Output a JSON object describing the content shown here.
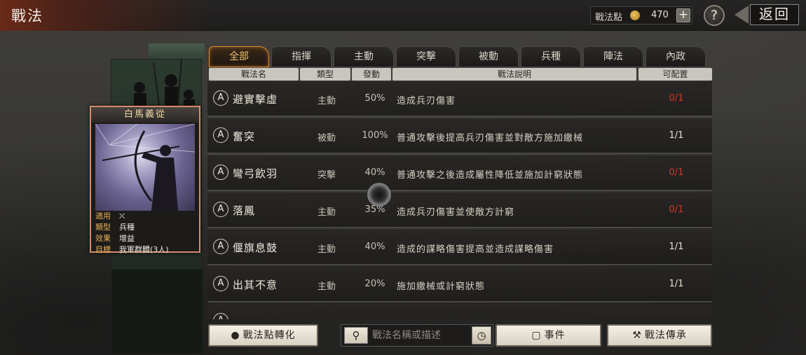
{
  "header": {
    "title": "戰法",
    "points_label": "戰法點",
    "points_icon": "coin-icon",
    "points_value": "470",
    "plus_label": "+",
    "help_label": "?",
    "back_label": "返回"
  },
  "card": {
    "name": "白馬義從",
    "info": [
      {
        "key": "適用",
        "value": "⛌"
      },
      {
        "key": "類型",
        "value": "兵種"
      },
      {
        "key": "效果",
        "value": "增益"
      },
      {
        "key": "目標",
        "value": "我軍群體(3人)"
      }
    ]
  },
  "tabs": [
    "全部",
    "指揮",
    "主動",
    "突擊",
    "被動",
    "兵種",
    "陣法",
    "內政"
  ],
  "active_tab": "全部",
  "columns": [
    "戰法名",
    "類型",
    "發動",
    "戰法說明",
    "可配置"
  ],
  "rows": [
    {
      "grade": "A",
      "name": "避實擊虛",
      "type": "主動",
      "rate": "50%",
      "desc": "造成兵刃傷害",
      "alloc": "0/1",
      "alloc_red": true
    },
    {
      "grade": "A",
      "name": "奮突",
      "type": "被動",
      "rate": "100%",
      "desc": "普通攻擊後提高兵刃傷害並對敵方施加繳械",
      "alloc": "1/1",
      "alloc_red": false
    },
    {
      "grade": "A",
      "name": "彎弓飲羽",
      "type": "突擊",
      "rate": "40%",
      "desc": "普通攻擊之後造成屬性降低並施加計窮狀態",
      "alloc": "0/1",
      "alloc_red": true
    },
    {
      "grade": "A",
      "name": "落鳳",
      "type": "主動",
      "rate": "35%",
      "desc": "造成兵刃傷害並使敵方計窮",
      "alloc": "0/1",
      "alloc_red": true
    },
    {
      "grade": "A",
      "name": "偃旗息鼓",
      "type": "主動",
      "rate": "40%",
      "desc": "造成的謀略傷害提高並造成謀略傷害",
      "alloc": "1/1",
      "alloc_red": false
    },
    {
      "grade": "A",
      "name": "出其不意",
      "type": "主動",
      "rate": "20%",
      "desc": "施加繳械或計窮狀態",
      "alloc": "1/1",
      "alloc_red": false
    },
    {
      "grade": "A",
      "name": "",
      "type": "",
      "rate": "",
      "desc": "",
      "alloc": "",
      "alloc_red": false
    }
  ],
  "bottom": {
    "convert_label": "戰法點轉化",
    "convert_icon": "flame-icon",
    "search_placeholder": "戰法名稱或描述",
    "event_label": "事件",
    "event_icon": "alert-icon",
    "inherit_label": "戰法傳承",
    "inherit_icon": "hammer-icon"
  },
  "colors": {
    "accent": "#e08a2a",
    "red": "#d8342a",
    "card_border": "#d38a6a"
  }
}
